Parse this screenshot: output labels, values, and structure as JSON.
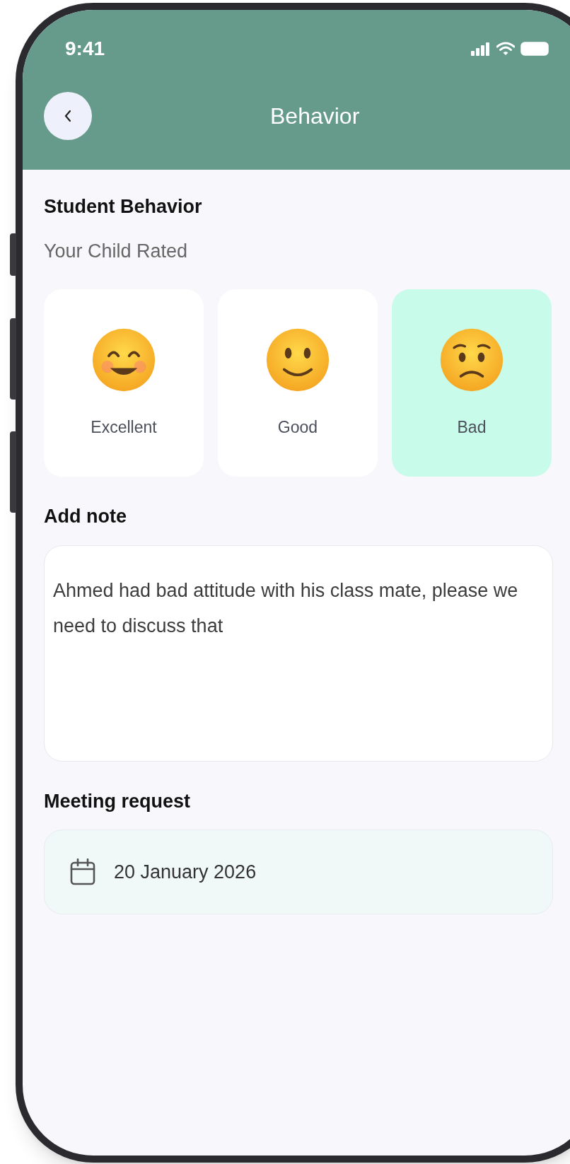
{
  "status_bar": {
    "time": "9:41"
  },
  "header": {
    "title": "Behavior"
  },
  "section": {
    "title": "Student Behavior",
    "subtitle": "Your Child Rated"
  },
  "ratings": [
    {
      "kind": "excellent",
      "label": "Excellent",
      "selected": false
    },
    {
      "kind": "good",
      "label": "Good",
      "selected": false
    },
    {
      "kind": "bad",
      "label": "Bad",
      "selected": true
    }
  ],
  "note": {
    "label": "Add note",
    "value": "Ahmed had bad attitude with his class mate, please we need to discuss that"
  },
  "meeting": {
    "label": "Meeting request",
    "date": "20 January 2026"
  }
}
